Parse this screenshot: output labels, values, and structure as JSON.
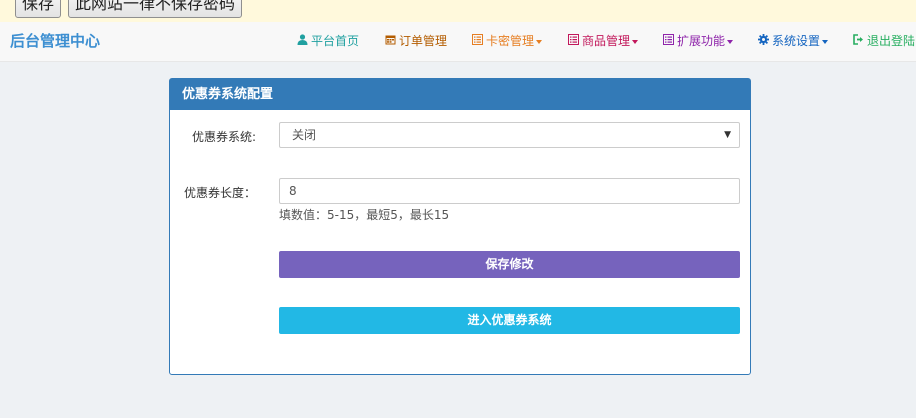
{
  "browser_bar": {
    "save_label": "保存",
    "never_label": "此网站一律不保存密码"
  },
  "navbar": {
    "brand": "后台管理中心",
    "items": [
      {
        "label": "平台首页",
        "icon": "user-icon",
        "color": "#20a0a0",
        "dropdown": false
      },
      {
        "label": "订单管理",
        "icon": "calendar-icon",
        "color": "#b35c00",
        "dropdown": false
      },
      {
        "label": "卡密管理",
        "icon": "list-icon",
        "color": "#e67e22",
        "dropdown": true
      },
      {
        "label": "商品管理",
        "icon": "list-alt-icon",
        "color": "#c2185b",
        "dropdown": true
      },
      {
        "label": "扩展功能",
        "icon": "list-alt-icon",
        "color": "#8e24aa",
        "dropdown": true
      },
      {
        "label": "系统设置",
        "icon": "gear-icon",
        "color": "#1565c0",
        "dropdown": true
      },
      {
        "label": "退出登陆",
        "icon": "logout-icon",
        "color": "#27ae60",
        "dropdown": false
      }
    ]
  },
  "panel": {
    "title": "优惠券系统配置",
    "system_label": "优惠券系统:",
    "system_value": "关闭",
    "length_label": "优惠券长度：",
    "length_value": "8",
    "length_help": "填数值：5-15，最短5，最长15",
    "save_button": "保存修改",
    "enter_button": "进入优惠券系统"
  },
  "colors": {
    "primary": "#337ab7",
    "save_button": "#7663bd",
    "enter_button": "#22b8e5"
  }
}
